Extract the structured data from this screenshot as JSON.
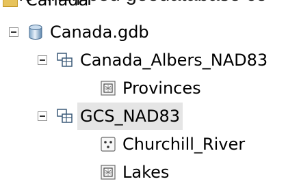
{
  "top_text": "The unzipped geodatabase co",
  "tree": {
    "root_folder": {
      "label": "Canada",
      "icon": "folder-icon"
    },
    "gdb": {
      "label": "Canada.gdb",
      "icon": "geodatabase-icon",
      "expanded": true
    },
    "datasets": [
      {
        "label": "Canada_Albers_NAD83",
        "icon": "feature-dataset-icon",
        "expanded": true,
        "children": [
          {
            "label": "Provinces",
            "icon": "polygon-feature-class-icon"
          }
        ]
      },
      {
        "label": "GCS_NAD83",
        "icon": "feature-dataset-icon",
        "expanded": true,
        "selected": true,
        "children": [
          {
            "label": "Churchill_River",
            "icon": "point-feature-class-icon"
          },
          {
            "label": "Lakes",
            "icon": "polygon-feature-class-icon"
          }
        ]
      }
    ]
  }
}
